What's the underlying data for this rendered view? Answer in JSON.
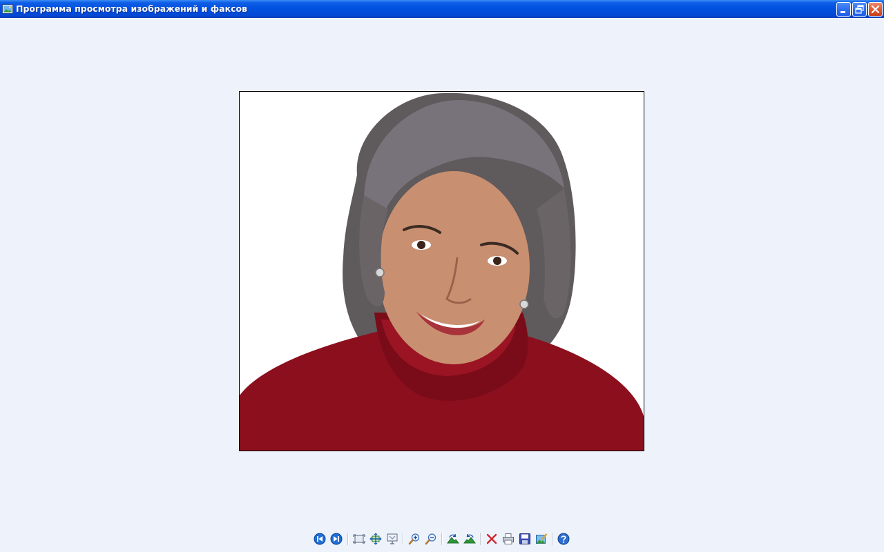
{
  "window": {
    "title": "Программа просмотра изображений и факсов",
    "app_icon": "image-viewer-icon",
    "controls": [
      "minimize-icon",
      "restore-icon",
      "close-icon"
    ]
  },
  "viewer": {
    "background_color": "#eef3fb",
    "image": {
      "subject": "portrait-photo",
      "sweater_color": "#8c0f1e",
      "hair_color": "#6f6a6b",
      "skin_color": "#c98f71"
    }
  },
  "toolbar": {
    "buttons": [
      "previous-image-icon",
      "next-image-icon",
      "best-fit-icon",
      "actual-size-icon",
      "slideshow-icon",
      "zoom-in-icon",
      "zoom-out-icon",
      "rotate-clockwise-icon",
      "rotate-counterclockwise-icon",
      "delete-icon",
      "print-icon",
      "save-as-icon",
      "edit-icon",
      "help-icon"
    ]
  }
}
